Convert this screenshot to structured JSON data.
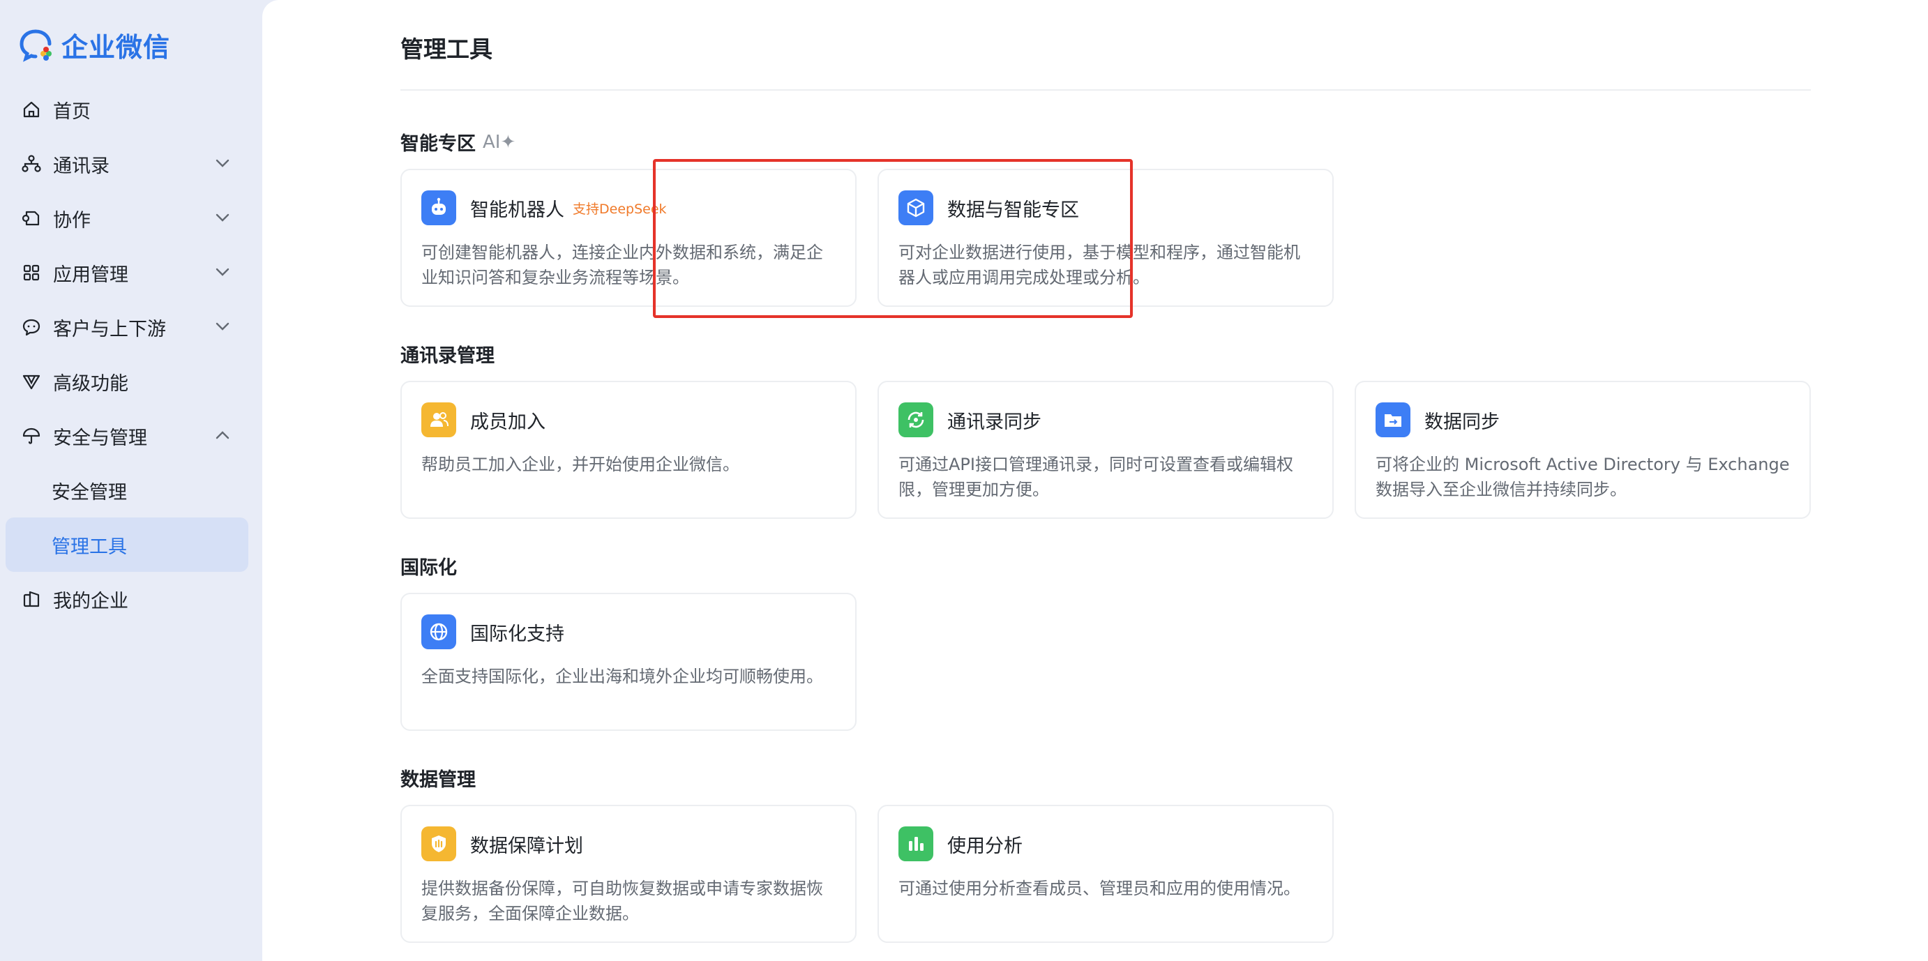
{
  "brand": {
    "name": "企业微信",
    "accent": "#2a73e6"
  },
  "sidebar": {
    "items": [
      {
        "label": "首页",
        "icon": "home-icon"
      },
      {
        "label": "通讯录",
        "icon": "org-chart-icon",
        "expandable": true
      },
      {
        "label": "协作",
        "icon": "collaboration-icon",
        "expandable": true
      },
      {
        "label": "应用管理",
        "icon": "grid-icon",
        "expandable": true
      },
      {
        "label": "客户与上下游",
        "icon": "chat-bubble-icon",
        "expandable": true
      },
      {
        "label": "高级功能",
        "icon": "v-icon"
      },
      {
        "label": "安全与管理",
        "icon": "umbrella-icon",
        "expanded": true
      },
      {
        "label": "安全管理"
      },
      {
        "label": "管理工具",
        "active": true
      },
      {
        "label": "我的企业",
        "icon": "building-icon"
      }
    ]
  },
  "main": {
    "title": "管理工具",
    "sections": [
      {
        "title": "智能专区",
        "tag": "AI✦",
        "cards": [
          {
            "name": "智能机器人",
            "badge": "支持DeepSeek",
            "desc": "可创建智能机器人，连接企业内外数据和系统，满足企业知识问答和复杂业务流程等场景。",
            "icon": "robot-icon",
            "color": "#3d7ef5"
          },
          {
            "name": "数据与智能专区",
            "desc": "可对企业数据进行使用，基于模型和程序，通过智能机器人或应用调用完成处理或分析。",
            "icon": "cube-icon",
            "color": "#3d7ef5"
          }
        ]
      },
      {
        "title": "通讯录管理",
        "cards": [
          {
            "name": "成员加入",
            "desc": "帮助员工加入企业，并开始使用企业微信。",
            "icon": "members-icon",
            "color": "#f5b731"
          },
          {
            "name": "通讯录同步",
            "desc": "可通过API接口管理通讯录，同时可设置查看或编辑权限，管理更加方便。",
            "icon": "sync-icon",
            "color": "#3ec164"
          },
          {
            "name": "数据同步",
            "desc": "可将企业的 Microsoft Active Directory 与 Exchange 数据导入至企业微信并持续同步。",
            "icon": "folder-icon",
            "color": "#3d7ef5"
          }
        ]
      },
      {
        "title": "国际化",
        "cards": [
          {
            "name": "国际化支持",
            "desc": "全面支持国际化，企业出海和境外企业均可顺畅使用。",
            "icon": "globe-icon",
            "color": "#3d7ef5"
          }
        ]
      },
      {
        "title": "数据管理",
        "cards": [
          {
            "name": "数据保障计划",
            "desc": "提供数据备份保障，可自助恢复数据或申请专家数据恢复服务，全面保障企业数据。",
            "icon": "shield-icon",
            "color": "#f5b731"
          },
          {
            "name": "使用分析",
            "desc": "可通过使用分析查看成员、管理员和应用的使用情况。",
            "icon": "bar-chart-icon",
            "color": "#3ec164"
          }
        ]
      }
    ]
  },
  "highlight_color": "#e5332a"
}
